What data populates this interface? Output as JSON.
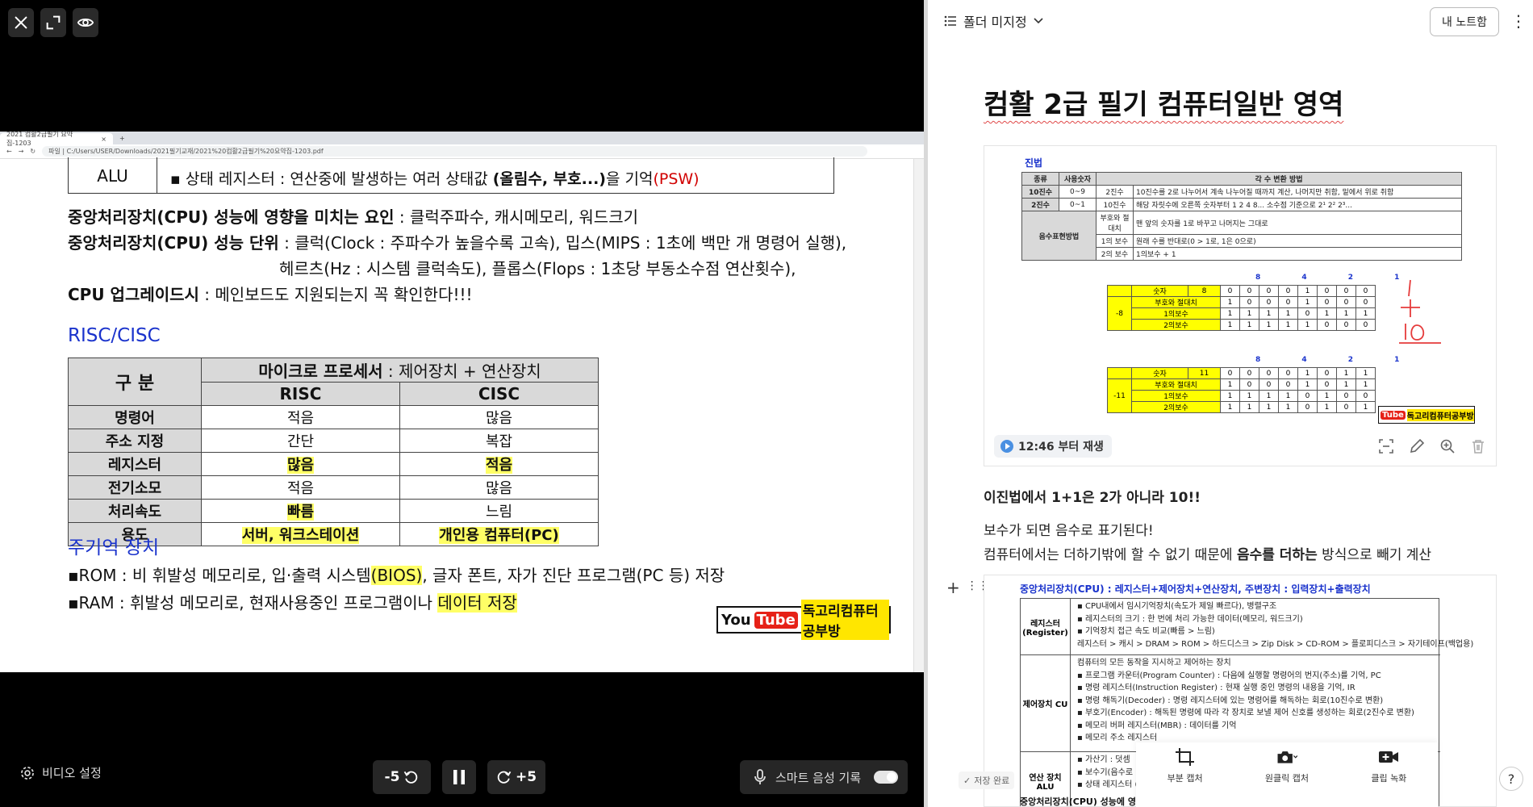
{
  "player": {
    "top_icons": [
      "close-icon",
      "expand-icon",
      "eye-icon"
    ],
    "browser": {
      "tab_title": "2021 컴활2급필기 요약집-1203",
      "address": "파일 | C:/Users/USER/Downloads/2021필기교재/2021%20컴활2급필기%20요약집-1203.pdf"
    },
    "doc": {
      "alu_label": "ALU",
      "alu_text_pre": "▪ 상태 레지스터 : 연산중에 발생하는 여러 상태값 ",
      "alu_text_bold": "(올림수, 부호...)",
      "alu_text_mid": "을 기억",
      "alu_text_red": "(PSW)",
      "line1_bold": "중앙처리장치(CPU) 성능에 영향을 미치는 요인",
      "line1_rest": " : 클럭주파수, 캐시메모리, 워드크기",
      "line2_bold": "중앙처리장치(CPU) 성능 단위",
      "line2_rest": " : 클럭(Clock : 주파수가 높을수록 고속), 밉스(MIPS : 1초에 백만 개 명령어 실행),",
      "line3": "헤르츠(Hz : 시스템 클럭속도), 플롭스(Flops : 1초당 부동소수점 연산횟수),",
      "line4_bold": "CPU 업그레이드시",
      "line4_rest": " : 메인보드도 지원되는지 꼭 확인한다!!!",
      "section_risc": "RISC/CISC",
      "table": {
        "corner": "구 분",
        "group_header_bold": "마이크로 프로세서",
        "group_header_rest": " : 제어장치 + 연산장치",
        "col_risc": "RISC",
        "col_cisc": "CISC",
        "rows": [
          {
            "label": "명령어",
            "risc": "적음",
            "cisc": "많음"
          },
          {
            "label": "주소 지정",
            "risc": "간단",
            "cisc": "복잡"
          },
          {
            "label": "레지스터",
            "risc": "많음",
            "cisc": "적음"
          },
          {
            "label": "전기소모",
            "risc": "적음",
            "cisc": "많음"
          },
          {
            "label": "처리속도",
            "risc": "빠름",
            "cisc": "느림"
          },
          {
            "label": "용도",
            "risc": "서버, 워크스테이션",
            "cisc": "개인용 컴퓨터(PC)"
          }
        ]
      },
      "section_memory": "주기억 장치",
      "rom_pre": "▪ROM : 비 휘발성 메모리로, 입·출력 시스템",
      "rom_bios": "(BIOS)",
      "rom_rest": ", 글자 폰트, 자가 진단 프로그램(PC 등) 저장",
      "ram_pre": "▪RAM : 휘발성 메모리로, 현재사용중인 프로그램이나 ",
      "ram_hl": "데이터 저장",
      "yt_you": "You",
      "yt_tube": "Tube",
      "yt_name": "독고리컴퓨터공부방"
    },
    "controls": {
      "video_settings": "비디오 설정",
      "rewind": "-5",
      "forward": "+5",
      "smart_record": "스마트 음성 기록",
      "smart_record_on": false
    }
  },
  "note": {
    "folder": "폴더 미지정",
    "my_note_button": "내 노트함",
    "title": "컴활 2급 필기 컴퓨터일반 영역",
    "capture1": {
      "title": "진법",
      "headers": [
        "종류",
        "사용숫자",
        "각 수 변환 방법"
      ],
      "rows": [
        [
          "10진수",
          "0~9",
          "2진수",
          "10진수를 2로 나누어서 계속 나누어질 때까지 계산, 나머지만 취함, 밑에서 위로 취함"
        ],
        [
          "2진수",
          "0~1",
          "10진수",
          "해당 자릿수에 오른쪽 숫자부터 1 2 4 8... 소수점 기준으로 2¹ 2² 2³..."
        ],
        [
          "음수표현방법",
          "",
          "부호와 절대치",
          "맨 앞의 숫자를 1로 바꾸고 나머지는 그대로"
        ],
        [
          "",
          "",
          "1의 보수",
          "원래 수를 반대로(0 > 1로, 1은 0으로)"
        ],
        [
          "",
          "",
          "2의 보수",
          "1의보수 + 1"
        ]
      ],
      "bin_head": "8 4 2 1",
      "bin_block1": [
        [
          "숫자",
          "8",
          "0",
          "0",
          "0",
          "0",
          "1",
          "0",
          "0",
          "0"
        ],
        [
          "부호와 절대치",
          "",
          "1",
          "0",
          "0",
          "0",
          "1",
          "0",
          "0",
          "0"
        ],
        [
          "1의보수",
          "",
          "1",
          "1",
          "1",
          "1",
          "0",
          "1",
          "1",
          "1"
        ],
        [
          "2의보수",
          "",
          "1",
          "1",
          "1",
          "1",
          "1",
          "0",
          "0",
          "0"
        ]
      ],
      "bin_label1": "-8",
      "bin_block2": [
        [
          "숫자",
          "11",
          "0",
          "0",
          "0",
          "0",
          "1",
          "0",
          "1",
          "1"
        ],
        [
          "부호와 절대치",
          "",
          "1",
          "0",
          "0",
          "0",
          "1",
          "0",
          "1",
          "1"
        ],
        [
          "1의보수",
          "",
          "1",
          "1",
          "1",
          "1",
          "0",
          "1",
          "0",
          "0"
        ],
        [
          "2의보수",
          "",
          "1",
          "1",
          "1",
          "1",
          "0",
          "1",
          "0",
          "1"
        ]
      ],
      "bin_label2": "-11",
      "yt_name": "독고리컴퓨터공부방",
      "play_label": "12:46 부터 재생"
    },
    "para1": "이진법에서 1+1은 2가 아니라 10!!",
    "para2": "보수가 되면 음수로 표기된다!",
    "para3_pre": "컴퓨터에서는 더하기밖에 할 수 없기 때문에 ",
    "para3_bold": "음수를 더하는",
    "para3_rest": " 방식으로 빼기 계산",
    "capture2": {
      "head": "중앙처리장치(CPU) : 레지스터+제어장치+연산장치,  주변장치 : 입력장치+출력장치",
      "reg_label": "레지스터 (Register)",
      "reg_lines": [
        "▪ CPU내에서 임시기억장치(속도가 제일 빠르다), 병렬구조",
        "▪ 레지스터의 크기 : 한 번에 처리 가능한 데이터(메모리, 워드크기)",
        "▪ 기억장치 접근 속도 비교(빠름 > 느림)",
        "레지스터 > 캐시 > DRAM > ROM > 하드디스크 > Zip Disk > CD-ROM > 플로피디스크 > 자기테이프(백업용)"
      ],
      "cu_label": "제어장치 CU",
      "cu_lines": [
        "컴퓨터의 모든 동작을 지시하고 제어하는 장치",
        "▪ 프로그램 카운터(Program Counter) : 다음에 실행할 명령어의 번지(주소)를 기억, PC",
        "▪ 명령 레지스터(Instruction Register) : 현재 실행 중인 명령의 내용을 기억, IR",
        "▪ 명령 해독기(Decoder) : 명령 레지스터에 있는 명령어를 해독하는 회로(10진수로 변환)",
        "▪ 부호기(Encoder) : 해독된 명령에 따라 각 장치로 보낼 제어 신호를 생성하는 회로(2진수로 변환)",
        "▪ 메모리 버퍼 레지스터(MBR) : 데이터를 기억",
        "▪ 메모리 주소 레지스터"
      ],
      "alu_label": "연산 장치 ALU",
      "alu_lines": [
        "▪ 가산기 : 덧셈",
        "▪ 보수기(음수로",
        "▪ 상태 레지스터                                                              (PSW)"
      ],
      "foot": "중앙처리장치(CPU) 성능에 영향을 미치는 요인 : 클럭주파수, 캐시메모리, 워드크기"
    },
    "toolbar": {
      "partial_capture": "부분 캡처",
      "one_click_capture": "원클릭 캡처",
      "clip_record": "클립 녹화"
    },
    "save_status": "저장 완료",
    "help": "?"
  }
}
